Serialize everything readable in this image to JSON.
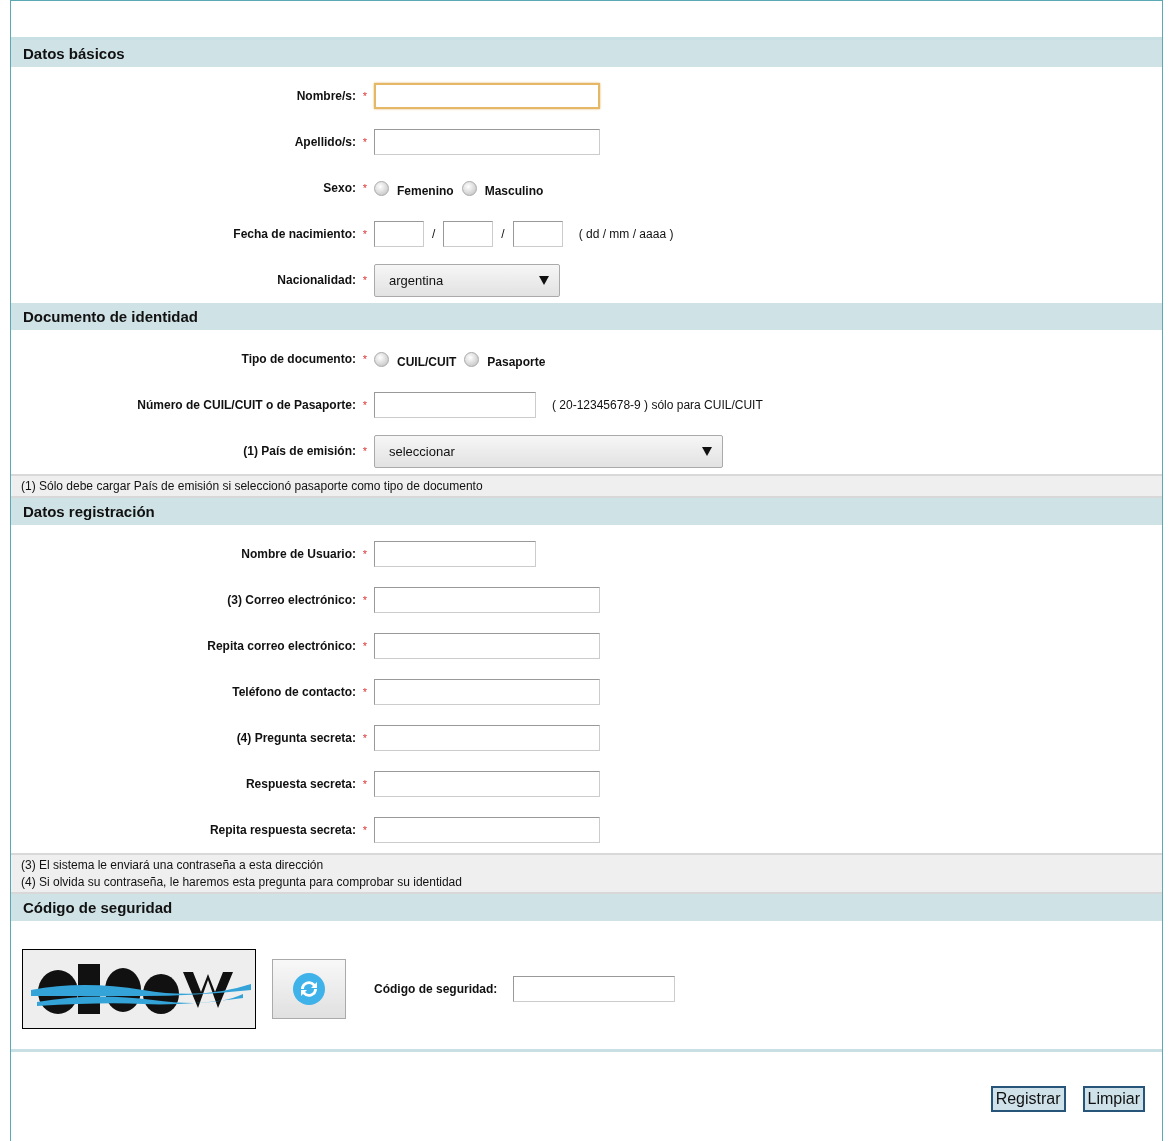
{
  "sections": [
    {
      "title": "Datos básicos",
      "rows": [
        {
          "kind": "text",
          "label": "Nombre/s:",
          "marker": "*",
          "focused": true
        },
        {
          "kind": "text",
          "label": "Apellido/s:",
          "marker": "*",
          "focused": false
        },
        {
          "kind": "radio",
          "label": "Sexo:",
          "marker": "*",
          "options": [
            {
              "label": "Femenino",
              "selected": false
            },
            {
              "label": "Masculino",
              "selected": false
            }
          ]
        },
        {
          "kind": "date",
          "label": "Fecha de nacimiento:",
          "marker": "*",
          "separators": [
            "/",
            "/"
          ],
          "hint": "( dd / mm / aaaa )"
        },
        {
          "kind": "select",
          "label": "Nacionalidad:",
          "marker": "*",
          "value": "argentina"
        }
      ]
    },
    {
      "title": "Documento de identidad",
      "rows": [
        {
          "kind": "radio",
          "label": "Tipo de documento:",
          "marker": "*",
          "options": [
            {
              "label": "CUIL/CUIT",
              "selected": false
            },
            {
              "label": "Pasaporte",
              "selected": false
            }
          ]
        },
        {
          "kind": "shorttext",
          "label": "Número de CUIL/CUIT o de Pasaporte:",
          "marker": "*",
          "focused": false,
          "hint": "( 20-12345678-9 ) sólo para CUIL/CUIT"
        },
        {
          "kind": "wideselect",
          "label": "(1) País de emisión:",
          "marker": "*",
          "value": "seleccionar"
        }
      ],
      "notes": [
        "(1) Sólo debe cargar País de emisión si seleccionó pasaporte como tipo de documento"
      ]
    },
    {
      "title": "Datos registración",
      "rows": [
        {
          "kind": "shorttext",
          "label": "Nombre de Usuario:",
          "marker": "*",
          "focused": false
        },
        {
          "kind": "text",
          "label": "(3) Correo electrónico:",
          "marker": "*",
          "focused": false
        },
        {
          "kind": "text",
          "label": "Repita correo electrónico:",
          "marker": "*",
          "focused": false
        },
        {
          "kind": "text",
          "label": "Teléfono de contacto:",
          "marker": "*",
          "focused": false
        },
        {
          "kind": "text",
          "label": "(4) Pregunta secreta:",
          "marker": "*",
          "focused": false
        },
        {
          "kind": "text",
          "label": "Respuesta secreta:",
          "marker": "*",
          "focused": false
        },
        {
          "kind": "text",
          "label": "Repita respuesta secreta:",
          "marker": "*",
          "focused": false
        }
      ],
      "notes": [
        "(3) El sistema le enviará una contraseña a esta dirección",
        "(4) Si olvida su contraseña, le haremos esta pregunta para comprobar su identidad"
      ]
    },
    {
      "title": "Código de seguridad",
      "rows": [
        {
          "kind": "captcha",
          "label": "Código de seguridad:"
        }
      ]
    }
  ],
  "buttons": [
    "Registrar",
    "Limpiar"
  ]
}
